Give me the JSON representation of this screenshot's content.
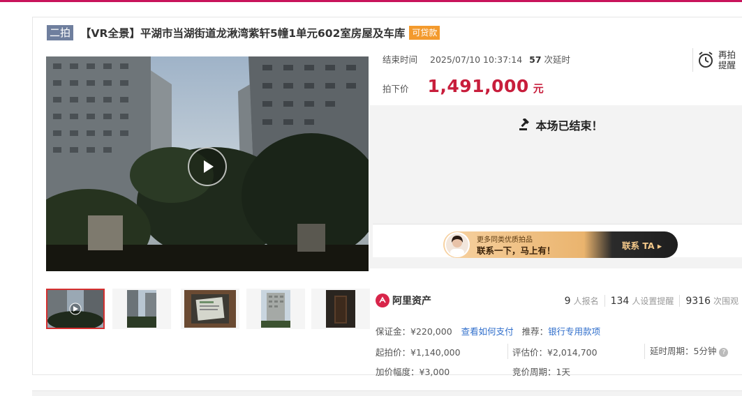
{
  "header": {
    "round_tag": "二拍",
    "title": "【VR全景】平湖市当湖街道龙湫湾紫轩5幢1单元602室房屋及车库",
    "loan_tag": "可贷款"
  },
  "auction": {
    "end_label": "结束时间",
    "end_time": "2025/07/10 10:37:14",
    "delay_count": "57",
    "delay_suffix": "次延时",
    "remind_line1": "再拍",
    "remind_line2": "提醒",
    "price_label": "拍下价",
    "price_value": "1,491,000",
    "price_unit": "元",
    "ended_text": "本场已结束！"
  },
  "banner": {
    "sub": "更多同类优质拍品",
    "main": "联系一下，马上有！",
    "cta": "联系 TA ▸"
  },
  "platform": {
    "name": "阿里资产"
  },
  "stats": [
    {
      "num": "9",
      "unit": "人报名"
    },
    {
      "num": "134",
      "unit": "人设置提醒"
    },
    {
      "num": "9316",
      "unit": "次围观"
    }
  ],
  "details": {
    "deposit": "保证金：¥220,000",
    "deposit_link": "查看如何支付",
    "recommend_label": "推荐：",
    "recommend_link": "银行专用款项",
    "start_price": "起拍价：¥1,140,000",
    "assess_price": "评估价：¥2,014,700",
    "delay_period": "延时周期：5分钟",
    "increment": "加价幅度：¥3,000",
    "bid_period": "竞价周期：1天"
  },
  "colors": {
    "accent_red": "#c81e3c",
    "top_line": "#c8135b",
    "link_blue": "#2f6ecb",
    "loan_orange": "#f39a2d",
    "round_tag_bg": "#6f7f9e"
  }
}
